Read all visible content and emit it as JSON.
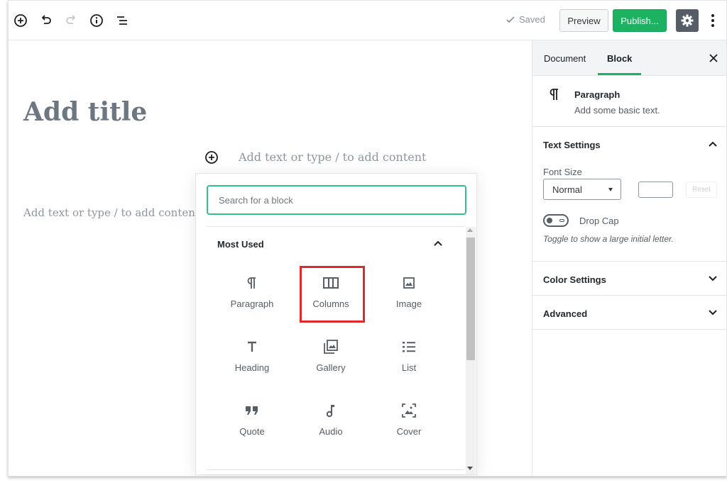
{
  "toolbar": {
    "add_icon": "plus-circle-icon",
    "undo_icon": "undo-icon",
    "redo_icon": "redo-icon",
    "info_icon": "info-icon",
    "outline_icon": "list-outline-icon",
    "saved_label": "Saved",
    "preview_label": "Preview",
    "publish_label": "Publish...",
    "settings_icon": "gear-icon",
    "more_icon": "more-vertical-icon"
  },
  "editor": {
    "title_placeholder": "Add title",
    "paragraph_placeholder": "Add text or type / to add content",
    "paragraph_placeholder_2": "Add text or type / to add content"
  },
  "inserter": {
    "search_placeholder": "Search for a block",
    "panel_title": "Most Used",
    "blocks": [
      {
        "label": "Paragraph",
        "icon": "paragraph-icon"
      },
      {
        "label": "Columns",
        "icon": "columns-icon"
      },
      {
        "label": "Image",
        "icon": "image-icon"
      },
      {
        "label": "Heading",
        "icon": "heading-icon"
      },
      {
        "label": "Gallery",
        "icon": "gallery-icon"
      },
      {
        "label": "List",
        "icon": "list-icon"
      },
      {
        "label": "Quote",
        "icon": "quote-icon"
      },
      {
        "label": "Audio",
        "icon": "audio-icon"
      },
      {
        "label": "Cover",
        "icon": "cover-icon"
      }
    ],
    "highlighted_block": "Columns"
  },
  "sidebar": {
    "tabs": [
      {
        "label": "Document"
      },
      {
        "label": "Block",
        "active": true
      }
    ],
    "block_card": {
      "title": "Paragraph",
      "description": "Add some basic text."
    },
    "text_settings": {
      "title": "Text Settings",
      "font_size_label": "Font Size",
      "font_size_value": "Normal",
      "reset_label": "Reset",
      "drop_cap_label": "Drop Cap",
      "drop_cap_help": "Toggle to show a large initial letter."
    },
    "color_settings_title": "Color Settings",
    "advanced_title": "Advanced"
  },
  "colors": {
    "accent_green": "#1db262",
    "highlight_red": "#e0292a",
    "search_border": "#33c18a"
  }
}
